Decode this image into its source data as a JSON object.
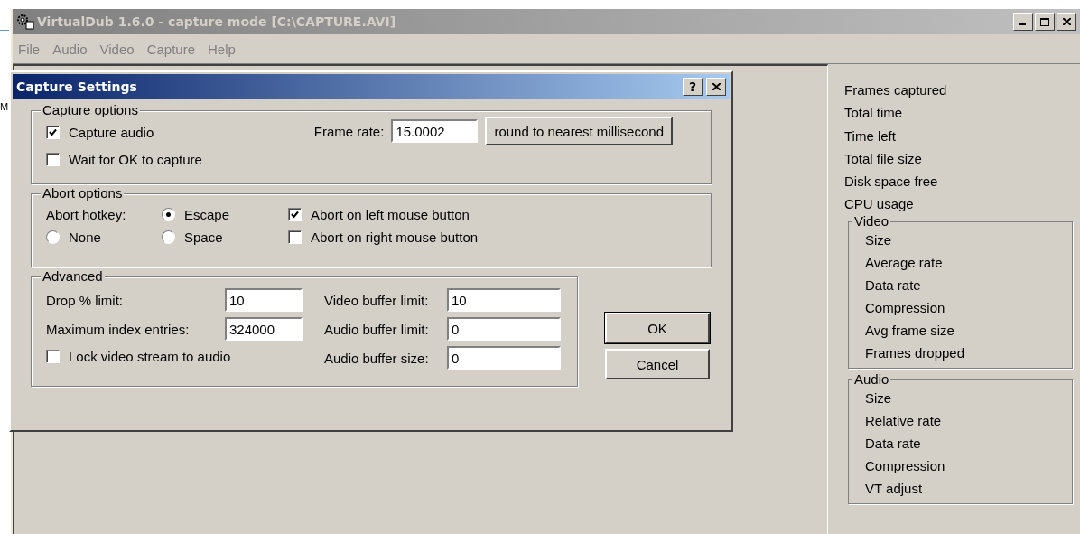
{
  "background": {
    "edge_text": "M"
  },
  "window": {
    "title": "VirtualDub 1.6.0 - capture mode [C:\\CAPTURE.AVI]",
    "active": false
  },
  "menu": [
    "File",
    "Audio",
    "Video",
    "Capture",
    "Help"
  ],
  "stats": {
    "items": [
      "Frames captured",
      "Total time",
      "Time left",
      "Total file size",
      "Disk space free",
      "CPU usage"
    ],
    "groups": [
      {
        "title": "Video",
        "items": [
          "Size",
          "Average rate",
          "Data rate",
          "Compression",
          "Avg frame size",
          "Frames dropped"
        ]
      },
      {
        "title": "Audio",
        "items": [
          "Size",
          "Relative rate",
          "Data rate",
          "Compression",
          "VT adjust"
        ]
      }
    ]
  },
  "dialog": {
    "title": "Capture Settings",
    "help": "?",
    "capture_options": {
      "title": "Capture options",
      "checkboxes": [
        {
          "label": "Capture audio",
          "checked": true
        },
        {
          "label": "Wait for OK to capture",
          "checked": false
        }
      ],
      "frame_rate": {
        "label": "Frame rate:",
        "value": "15.0002"
      },
      "round_button": "round to nearest millisecond"
    },
    "abort_options": {
      "title": "Abort options",
      "hotkey_label": "Abort hotkey:",
      "radios": [
        {
          "label": "Escape",
          "selected": true
        },
        {
          "label": "None",
          "selected": false
        },
        {
          "label": "Space",
          "selected": false
        }
      ],
      "checkboxes": [
        {
          "label": "Abort on left mouse button",
          "checked": true
        },
        {
          "label": "Abort on right mouse button",
          "checked": false
        }
      ]
    },
    "advanced": {
      "title": "Advanced",
      "left_fields": [
        {
          "label": "Drop % limit:",
          "value": "10"
        },
        {
          "label": "Maximum index entries:",
          "value": "324000"
        }
      ],
      "lock": {
        "label": "Lock video stream to audio",
        "checked": false
      },
      "right_fields": [
        {
          "label": "Video buffer limit:",
          "value": "10"
        },
        {
          "label": "Audio buffer limit:",
          "value": "0"
        },
        {
          "label": "Audio buffer size:",
          "value": "0"
        }
      ]
    },
    "buttons": [
      "OK",
      "Cancel"
    ]
  }
}
